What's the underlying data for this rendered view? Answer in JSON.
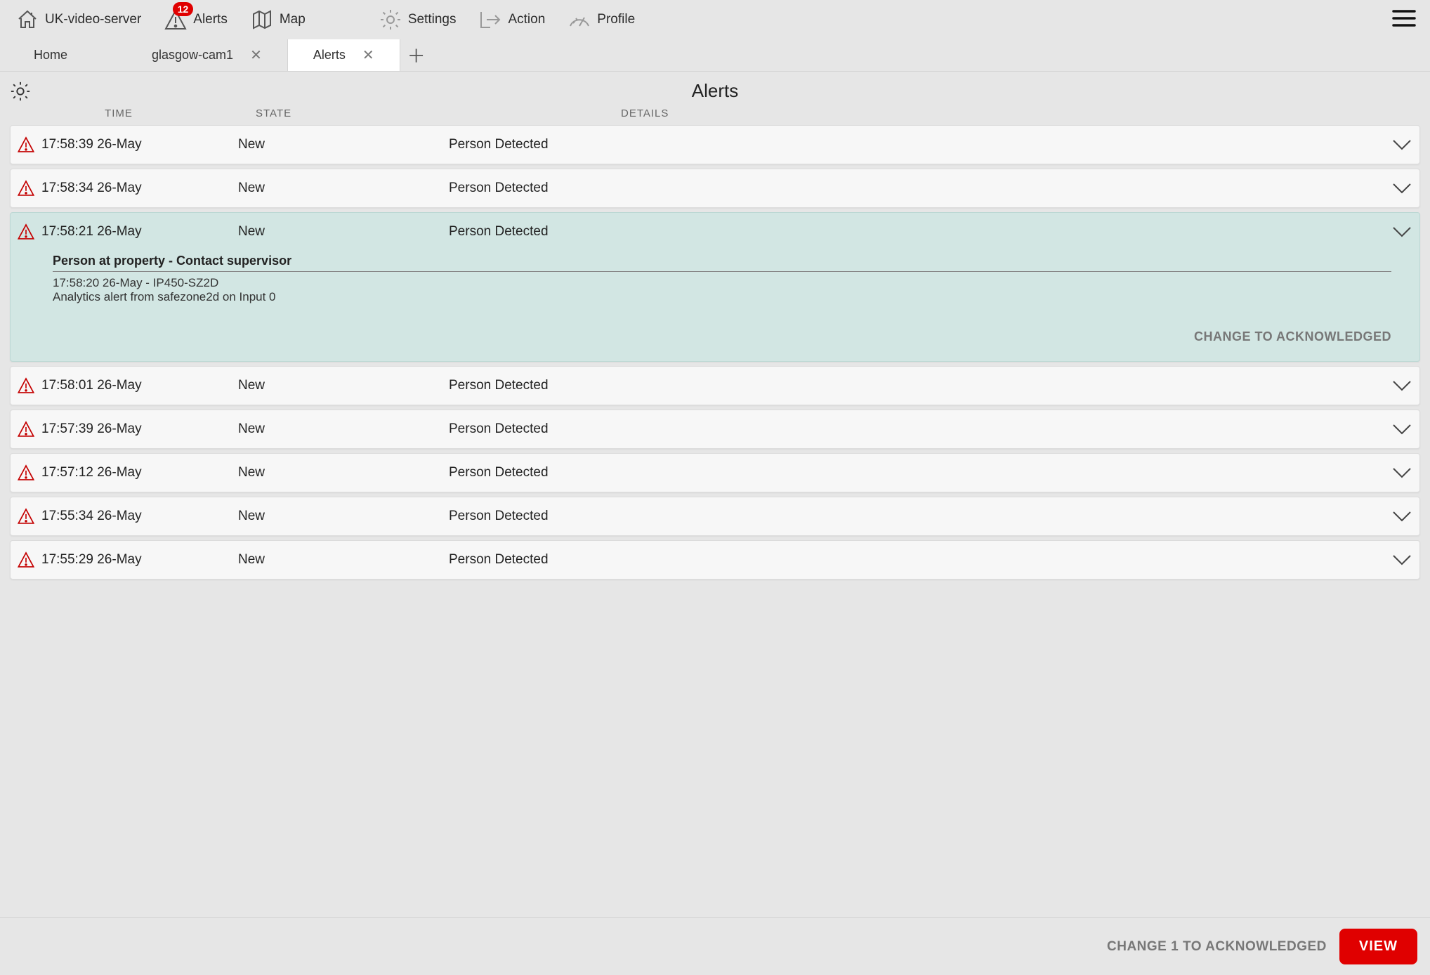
{
  "nav": {
    "server_label": "UK-video-server",
    "alerts_label": "Alerts",
    "alerts_badge": "12",
    "map_label": "Map",
    "settings_label": "Settings",
    "action_label": "Action",
    "profile_label": "Profile"
  },
  "tabs": {
    "home": "Home",
    "items": [
      {
        "label": "glasgow-cam1",
        "active": false
      },
      {
        "label": "Alerts",
        "active": true
      }
    ]
  },
  "page": {
    "title": "Alerts"
  },
  "columns": {
    "time": "TIME",
    "state": "STATE",
    "details": "DETAILS"
  },
  "alerts": [
    {
      "time": "17:58:39 26-May",
      "state": "New",
      "details": "Person Detected",
      "expanded": false
    },
    {
      "time": "17:58:34 26-May",
      "state": "New",
      "details": "Person Detected",
      "expanded": false
    },
    {
      "time": "17:58:21 26-May",
      "state": "New",
      "details": "Person Detected",
      "expanded": true,
      "body": {
        "title": "Person at property - Contact supervisor",
        "meta1": "17:58:20 26-May - IP450-SZ2D",
        "meta2": "Analytics alert from safezone2d on Input 0",
        "ack": "CHANGE TO ACKNOWLEDGED"
      }
    },
    {
      "time": "17:58:01 26-May",
      "state": "New",
      "details": "Person Detected",
      "expanded": false
    },
    {
      "time": "17:57:39 26-May",
      "state": "New",
      "details": "Person Detected",
      "expanded": false
    },
    {
      "time": "17:57:12 26-May",
      "state": "New",
      "details": "Person Detected",
      "expanded": false
    },
    {
      "time": "17:55:34 26-May",
      "state": "New",
      "details": "Person Detected",
      "expanded": false
    },
    {
      "time": "17:55:29 26-May",
      "state": "New",
      "details": "Person Detected",
      "expanded": false
    }
  ],
  "footer": {
    "ack": "CHANGE 1 TO ACKNOWLEDGED",
    "view": "VIEW"
  }
}
